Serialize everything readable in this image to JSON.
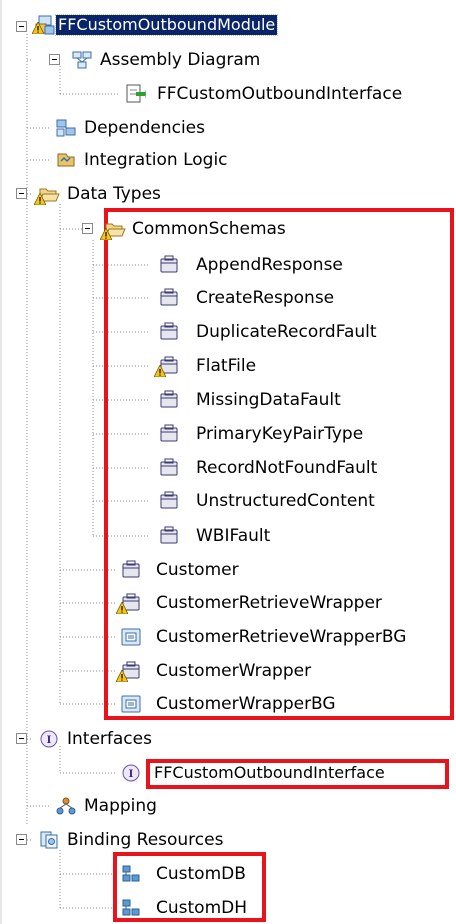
{
  "tree": {
    "module": "FFCustomOutboundModule",
    "assembly_diagram": "Assembly Diagram",
    "assembly_interface": "FFCustomOutboundInterface",
    "dependencies": "Dependencies",
    "integration_logic": "Integration Logic",
    "data_types": "Data Types",
    "common_schemas": "CommonSchemas",
    "schemas": [
      "AppendResponse",
      "CreateResponse",
      "DuplicateRecordFault",
      "FlatFile",
      "MissingDataFault",
      "PrimaryKeyPairType",
      "RecordNotFoundFault",
      "UnstructuredContent",
      "WBIFault"
    ],
    "types": [
      "Customer",
      "CustomerRetrieveWrapper",
      "CustomerRetrieveWrapperBG",
      "CustomerWrapper",
      "CustomerWrapperBG"
    ],
    "interfaces": "Interfaces",
    "interface_item": "FFCustomOutboundInterface",
    "mapping": "Mapping",
    "binding_resources": "Binding Resources",
    "bindings": [
      "CustomDB",
      "CustomDH"
    ]
  },
  "colors": {
    "highlight": "#e8131b",
    "selection": "#0a246a"
  }
}
